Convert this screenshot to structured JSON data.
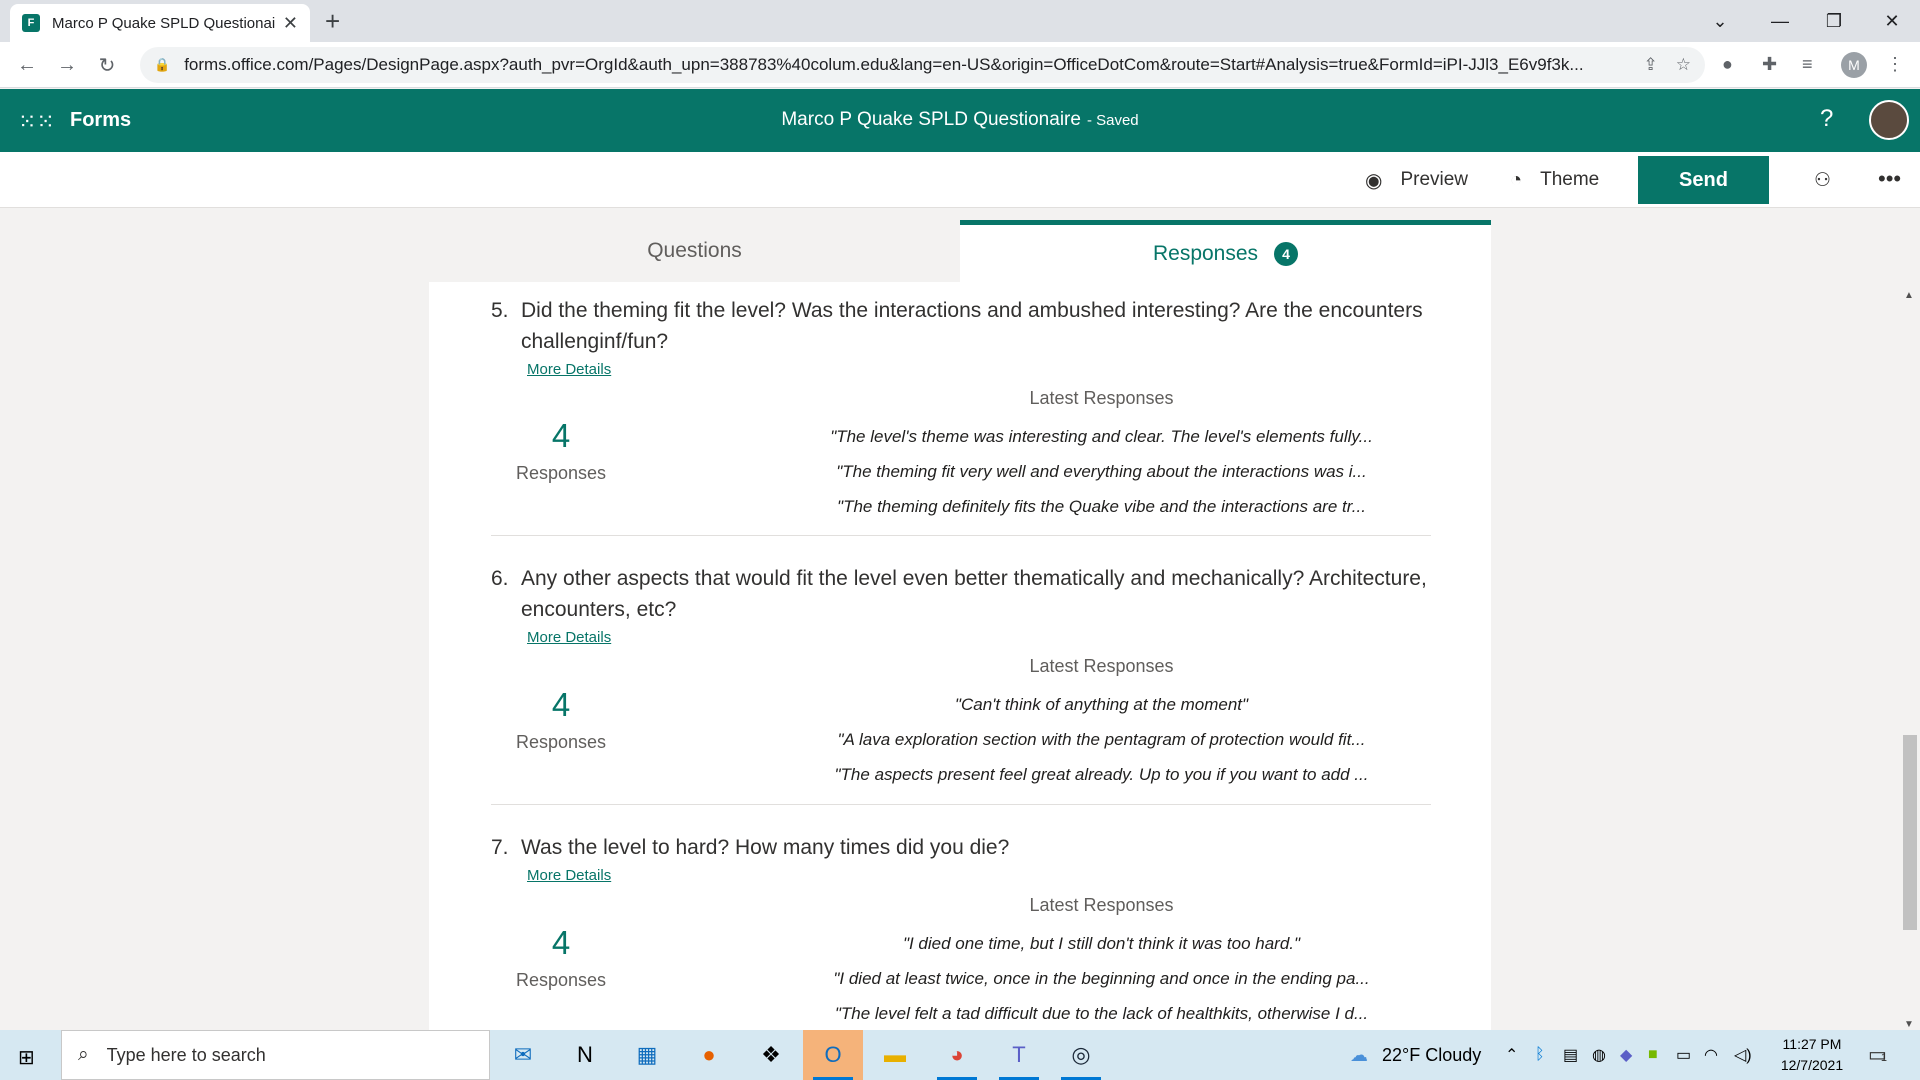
{
  "browser": {
    "tab_title": "Marco P Quake SPLD Questionaire",
    "tab_close": "✕",
    "new_tab": "+",
    "url": "forms.office.com/Pages/DesignPage.aspx?auth_pvr=OrgId&auth_upn=388783%40colum.edu&lang=en-US&origin=OfficeDotCom&route=Start#Analysis=true&FormId=iPI-JJl3_E6v9f3k...",
    "profile_initial": "M"
  },
  "header": {
    "app_name": "Forms",
    "form_title": "Marco P Quake SPLD Questionaire",
    "save_state": "- Saved",
    "help": "?"
  },
  "commands": {
    "preview": "Preview",
    "theme": "Theme",
    "send": "Send",
    "more": "•••"
  },
  "tabs": {
    "questions": "Questions",
    "responses": "Responses",
    "responses_count": "4"
  },
  "questions": [
    {
      "number": "5.",
      "text": "Did the theming fit the level? Was the interactions and ambushed interesting? Are the encounters challenginf/fun?",
      "more_details": "More Details",
      "count": "4",
      "count_label": "Responses",
      "latest_header": "Latest Responses",
      "responses": [
        "\"The level's theme was interesting and clear. The level's elements fully...",
        "\"The theming fit very well and everything about the interactions was i...",
        "\"The theming definitely fits the Quake vibe and the interactions are tr..."
      ]
    },
    {
      "number": "6.",
      "text": "Any other aspects that would fit the level even better thematically and mechanically? Architecture, encounters, etc?",
      "more_details": "More Details",
      "count": "4",
      "count_label": "Responses",
      "latest_header": "Latest Responses",
      "responses": [
        "\"Can't think of anything at the moment\"",
        "\"A lava exploration section with the pentagram of protection would fit...",
        "\"The aspects present feel great already. Up to you if you want to add ..."
      ]
    },
    {
      "number": "7.",
      "text": "Was the level to hard? How many times did you die?",
      "more_details": "More Details",
      "count": "4",
      "count_label": "Responses",
      "latest_header": "Latest Responses",
      "responses": [
        "\"I died one time, but I still don't think it was too hard.\"",
        "\"I died at least twice, once in the beginning and once in the ending pa...",
        "\"The level felt a tad difficult due to the lack of healthkits, otherwise I d..."
      ]
    }
  ],
  "taskbar": {
    "search_placeholder": "Type here to search",
    "weather": "22°F  Cloudy",
    "time": "11:27 PM",
    "date": "12/7/2021",
    "notification_count": "1"
  },
  "colors": {
    "brand": "#077568",
    "taskbar": "#d6e8f2"
  }
}
